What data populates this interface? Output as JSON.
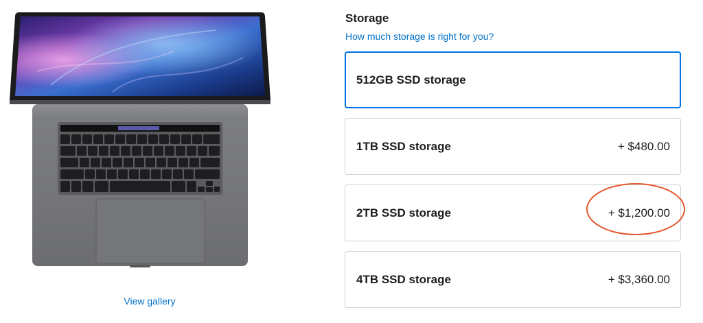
{
  "product": {
    "view_gallery_label": "View gallery"
  },
  "storage": {
    "title": "Storage",
    "help_link": "How much storage is right for you?",
    "options": [
      {
        "label": "512GB SSD storage",
        "price": "",
        "selected": true
      },
      {
        "label": "1TB SSD storage",
        "price": "+ $480.00",
        "selected": false
      },
      {
        "label": "2TB SSD storage",
        "price": "+ $1,200.00",
        "selected": false
      },
      {
        "label": "4TB SSD storage",
        "price": "+ $3,360.00",
        "selected": false
      }
    ]
  },
  "colors": {
    "link": "#0070c9",
    "selected_border": "#0071e3",
    "annotation": "#e4572e"
  }
}
